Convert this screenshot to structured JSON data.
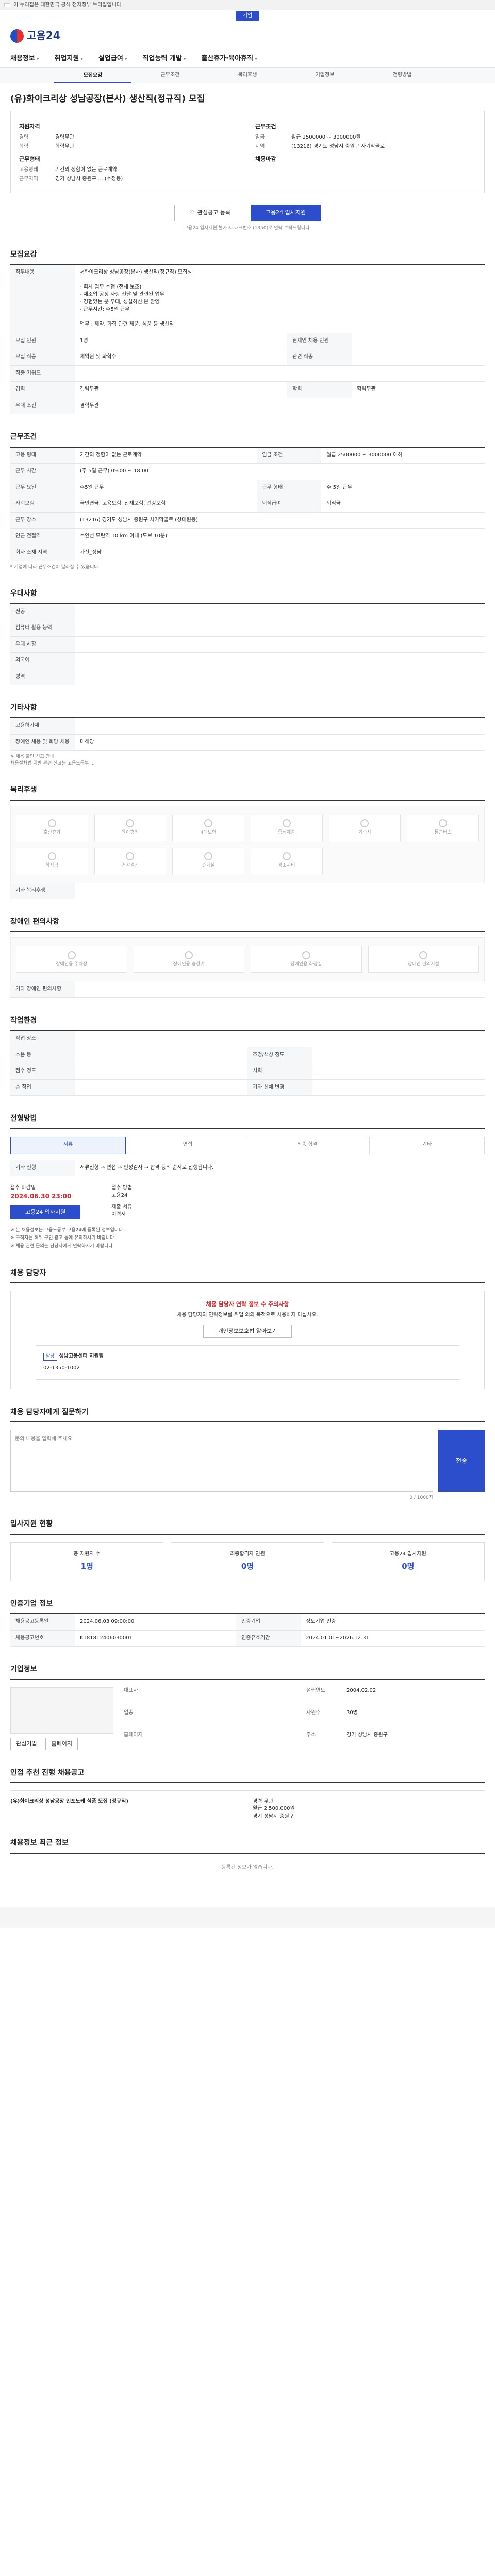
{
  "banner": {
    "text": "이 누리집은 대한민국 공식 전자정부 누리집입니다."
  },
  "topbar": {
    "links": [
      "기업"
    ]
  },
  "header": {
    "logo_text": "고용24"
  },
  "gnb": [
    "채용정보",
    "취업지원",
    "실업급여",
    "직업능력 개발",
    "출산휴가·육아휴직"
  ],
  "subtabs": [
    "모집요강",
    "근무조건",
    "복리후생",
    "기업정보",
    "전형방법",
    "",
    "",
    "",
    ""
  ],
  "title": "(유)화이크리상 성남공장(본사) 생산직(정규직) 모집",
  "summary": {
    "left_head": "지원자격",
    "left": [
      [
        "경력",
        "경력무관"
      ],
      [
        "학력",
        "학력무관"
      ]
    ],
    "left_head2": "근무형태",
    "left2": [
      [
        "고용형태",
        "기간의 정함이 없는 근로계약"
      ],
      [
        "근무지역",
        "경기 성남시 중원구 ... (수정동)"
      ]
    ],
    "right_head": "근무조건",
    "right": [
      [
        "임금",
        "월급 2500000 ~ 3000000원"
      ],
      [
        "지역",
        "(13216) 경기도 성남시 중원구 사기막골로"
      ]
    ],
    "right_head2": "채용마감"
  },
  "buttons": {
    "scrap": "관심공고 등록",
    "apply": "고용24 입사지원"
  },
  "summary_note": "고용24 입사지원 불가 시 대표번호 (1350)로 연락 부탁드립니다.",
  "recruit": {
    "heading": "모집요강",
    "job_title_label": "직무내용",
    "job_desc": "<화이크리상 성남공장(본사) 생산직(정규직) 모집>\n\n- 회사 업무 수행 (전체 보조)\n- 제조업 공정 사항 전달 및 관련된 업무\n- 경험있는 분 우대, 성실하신 분 환영\n- 근무시간: 주5일 근무\n\n업무 : 제약, 화학 관련 제품, 식품 등 생산직",
    "rows": [
      [
        "모집 인원",
        "1명",
        "현재인 채용 인원",
        ""
      ],
      [
        "모집 직종",
        "제약원 및 화학수",
        "관련 직종",
        ""
      ],
      [
        "직종 키워드",
        "",
        "",
        ""
      ],
      [
        "경력",
        "경력무관",
        "학력",
        "학력무관"
      ],
      [
        "우대 조건",
        "경력무관",
        "",
        ""
      ]
    ]
  },
  "conditions": {
    "heading": "근무조건",
    "rows": [
      [
        "고용 형태",
        "기간의 정함이 없는 근로계약",
        "임금 조건",
        "월급 2500000 ~ 3000000 이하"
      ],
      [
        "근무 시간",
        "(주 5일 근무) 09:00 ~ 18:00",
        ""
      ],
      [
        "근무 요일",
        "주5일 근무",
        "근무 형태",
        "주 5일 근무"
      ],
      [
        "사회보험",
        "국민연금, 고용보험, 산재보험, 건강보험",
        "퇴직급여",
        "퇴직금"
      ],
      [
        "근무 장소",
        "(13216) 경기도 성남시 중원구 사기막골로 (상대원동)",
        "",
        ""
      ],
      [
        "인근 전철역",
        "수인선 모란역 10 km 이내 (도보 10분)",
        "",
        ""
      ],
      [
        "회사 소재 지역",
        "가산_정남",
        "",
        ""
      ]
    ],
    "note": "* 기업에 따라 근무조건이 달라질 수 있습니다."
  },
  "prefer": {
    "heading": "우대사항",
    "rows": [
      [
        "전공",
        ""
      ],
      [
        "컴퓨터 활용 능력",
        ""
      ],
      [
        "우대 사항",
        ""
      ],
      [
        "외국어",
        ""
      ],
      [
        "병역",
        ""
      ]
    ]
  },
  "other": {
    "heading": "기타사항",
    "rows": [
      [
        "고용허가제",
        ""
      ],
      [
        "장애인 채용 및 희망 채용",
        "미해당"
      ]
    ],
    "notes": "※ 채용 불만 신고 안내\n채용절차법 위반 관련 신고는 고용노동부 ..."
  },
  "welfare": {
    "heading": "복리후생",
    "icons": [
      "출산휴가",
      "육아휴직",
      "4대보험",
      "중식제공",
      "기숙사",
      "통근버스",
      "학자금",
      "건강검진",
      "휴게실",
      "경조사비",
      "",
      ""
    ],
    "etc_label": "기타 복리후생"
  },
  "disability": {
    "heading": "장애인 편의사항",
    "icons": [
      "장애인용 주차장",
      "장애인용 승강기",
      "장애인용 화장실",
      "장애인 편의시설"
    ],
    "etc_label": "기타 장애인 편의사항"
  },
  "conditions2": {
    "heading": "작업환경",
    "rows": [
      [
        "작업 장소",
        ""
      ],
      [
        "소음 등",
        "",
        "조명/색상 정도",
        ""
      ],
      [
        "점수 정도",
        "",
        "시력",
        ""
      ],
      [
        "손 작업",
        "",
        "기타 신체 변경",
        ""
      ]
    ]
  },
  "process": {
    "heading": "전형방법",
    "steps": [
      "서류",
      "면접",
      "최종 합격",
      "기타"
    ],
    "etc_label": "기타 전형",
    "etc": "서류전형 → 면접 → 인성검사 → 합격 등의 순서로 진행됩니다.",
    "deadline_label": "접수 마감일",
    "deadline": "2024.06.30 23:00",
    "apply_method_label": "접수 방법",
    "apply_method": "고용24",
    "docs_label": "제출 서류",
    "docs": "이력서",
    "apply_btn": "고용24 입사지원"
  },
  "notes_list": "※ 본 채용정보는 고용노동부 고용24에 등록된 정보입니다.\n※ 구직자는 허위 구인 광고 등에 유의하시기 바랍니다.\n※ 채용 관련 문의는 담당자에게 연락하시기 바랍니다.",
  "manager": {
    "heading": "채용 담당자",
    "alert": "채용 담당자 연락 정보 수 주의사항",
    "alert_body": "채용 담당자의 연락정보를 취업 외의 목적으로 사용하지 마십시오.",
    "btn": "개인정보보호법 알아보기",
    "name": "성남고용센터 지원팀",
    "phone": "02-1350-1002",
    "fax": "팩스"
  },
  "qna": {
    "heading": "채용 담당자에게 질문하기",
    "placeholder": "문의 내용을 입력해 주세요.",
    "count": "0 / 1000자",
    "send": "전송"
  },
  "applicants": {
    "heading": "입사지원 현황",
    "cards": [
      [
        "총 지원자 수",
        "1명"
      ],
      [
        "최종합격자 인원",
        "0명"
      ],
      [
        "고용24 입사지원",
        "0명"
      ]
    ]
  },
  "history": {
    "heading": "인증기업 정보",
    "rows": [
      [
        "채용공고등록일",
        "2024.06.03 09:00:00",
        "인증기업",
        "정도기업 인증"
      ],
      [
        "채용공고번호",
        "K181812406030001",
        "인증유효기간",
        "2024.01.01~2026.12.31"
      ]
    ]
  },
  "company": {
    "heading": "기업정보",
    "name": "(유)화이크리상",
    "rows": [
      [
        "대표자",
        "",
        "설립연도",
        "2004.02.02"
      ],
      [
        "업종",
        "",
        "사원수",
        "30명"
      ],
      [
        "홈페이지",
        "",
        "주소",
        "경기 성남시 중원구"
      ]
    ],
    "btn1": "관심기업",
    "btn2": "홈페이지"
  },
  "related": {
    "heading": "인접 추천 진행 채용공고",
    "item_title": "(유)화이크리상 성남공장 인포노케 식품 모집 (정규직)",
    "item_meta": [
      "경력 무관",
      "월급 2,500,000원",
      "경기 성남시 중원구"
    ]
  },
  "bottom": {
    "heading": "채용정보 최근 정보",
    "empty": "등록된 정보가 없습니다."
  }
}
